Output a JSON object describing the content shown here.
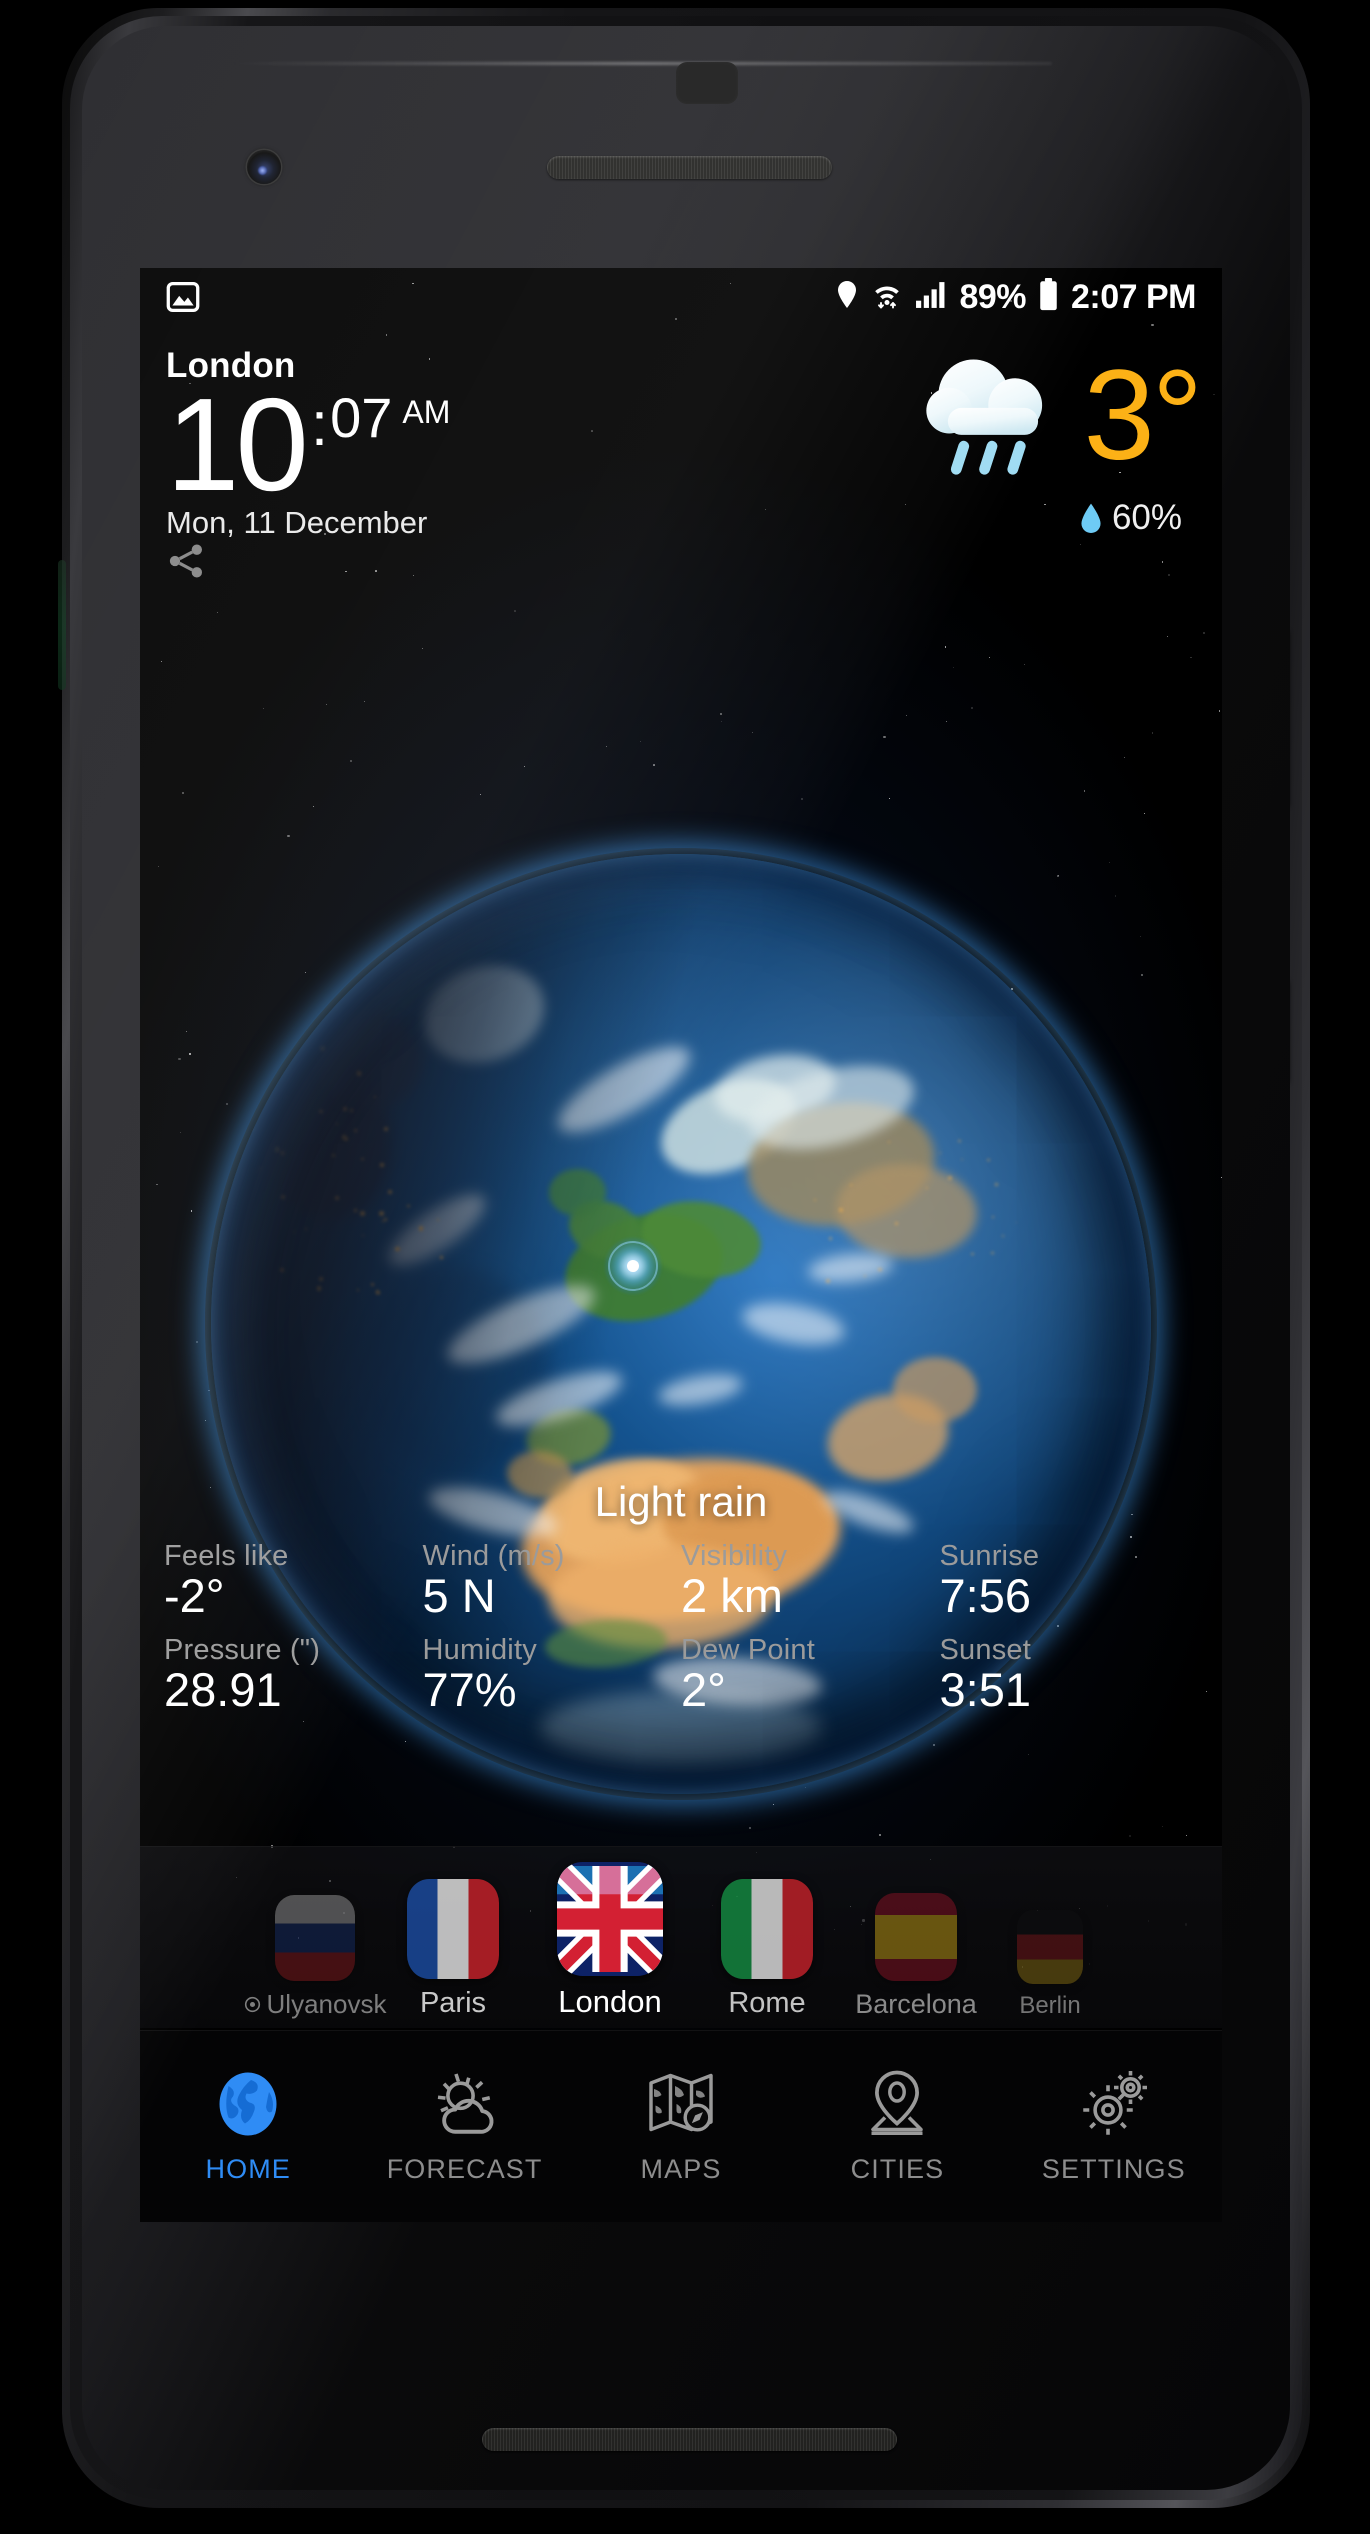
{
  "status_bar": {
    "gallery_icon": "photo-icon",
    "location_icon": "location-pin-icon",
    "wifi_icon": "wifi-icon",
    "signal_icon": "signal-bars-icon",
    "battery_percent": "89%",
    "battery_icon": "battery-icon",
    "system_time": "2:07 PM"
  },
  "header": {
    "city": "London",
    "clock_hours": "10",
    "clock_separator": ":",
    "clock_minutes": "07",
    "clock_meridiem": "AM",
    "date": "Mon, 11 December",
    "share_icon": "share-icon"
  },
  "current_weather": {
    "icon": "rain-cloud-icon",
    "temperature": "3",
    "degree_symbol": "°",
    "precipitation_icon": "water-drop-icon",
    "precipitation": "60%",
    "condition": "Light rain",
    "accent_color": "#fcb116",
    "drop_color": "#6ecbf5"
  },
  "globe": {
    "marker_icon": "location-pulse-marker"
  },
  "stats": {
    "row1": [
      {
        "label": "Feels like",
        "value": "-2°"
      },
      {
        "label": "Wind (m/s)",
        "value": "5 N"
      },
      {
        "label": "Visibility",
        "value": "2 km"
      },
      {
        "label": "Sunrise",
        "value": "7:56"
      }
    ],
    "row2": [
      {
        "label": "Pressure (\")",
        "value": "28.91"
      },
      {
        "label": "Humidity",
        "value": "77%"
      },
      {
        "label": "Dew Point",
        "value": "2°"
      },
      {
        "label": "Sunset",
        "value": "3:51"
      }
    ]
  },
  "cities": [
    {
      "name": "Ulyanovsk",
      "flag": "russia-flag",
      "selected": false,
      "gps": true,
      "gps_icon": "gps-target-icon"
    },
    {
      "name": "Paris",
      "flag": "france-flag",
      "selected": false,
      "gps": false
    },
    {
      "name": "London",
      "flag": "united-kingdom-flag",
      "selected": true,
      "gps": false
    },
    {
      "name": "Rome",
      "flag": "italy-flag",
      "selected": false,
      "gps": false
    },
    {
      "name": "Barcelona",
      "flag": "spain-flag",
      "selected": false,
      "gps": false
    },
    {
      "name": "Berlin",
      "flag": "germany-flag",
      "selected": false,
      "gps": false
    }
  ],
  "nav": [
    {
      "label": "HOME",
      "icon": "globe-icon",
      "active": true
    },
    {
      "label": "FORECAST",
      "icon": "sun-cloud-icon",
      "active": false
    },
    {
      "label": "MAPS",
      "icon": "map-icon",
      "active": false
    },
    {
      "label": "CITIES",
      "icon": "map-pin-icon",
      "active": false
    },
    {
      "label": "SETTINGS",
      "icon": "gears-icon",
      "active": false
    }
  ],
  "theme": {
    "active_blue": "#2f8cf5",
    "muted_gray": "#8d8d8d",
    "label_gray": "#9b9b9b"
  }
}
